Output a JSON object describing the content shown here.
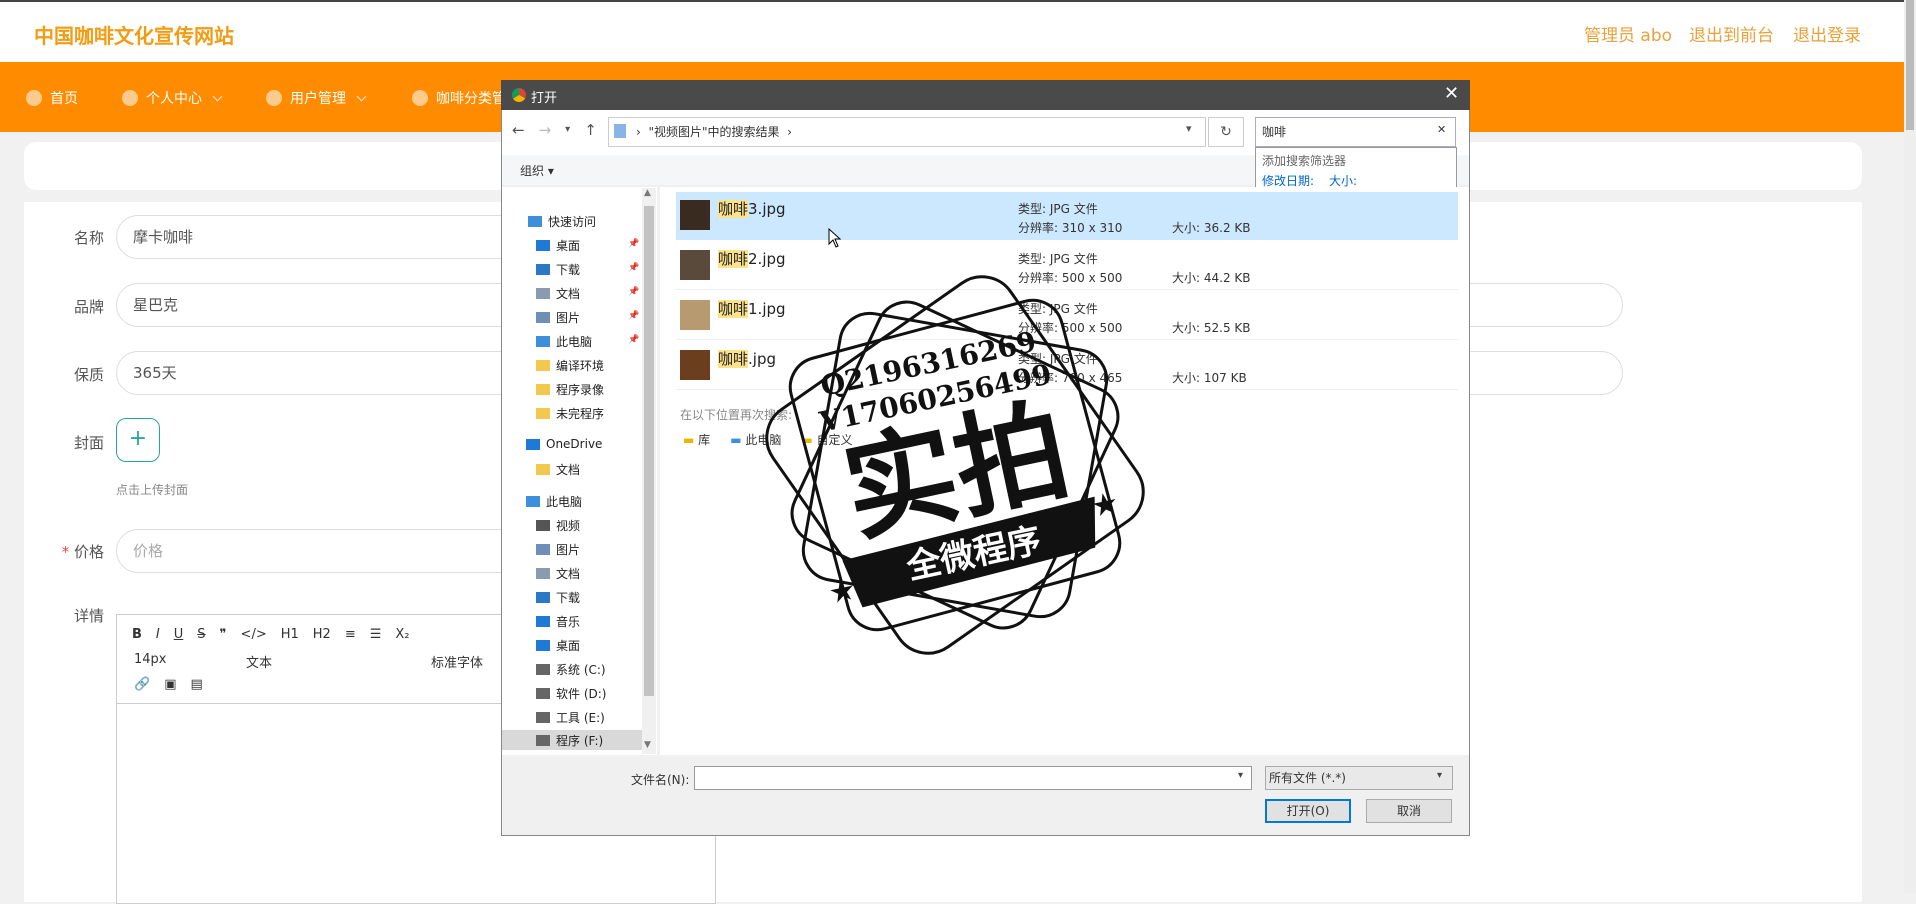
{
  "header": {
    "site_title": "中国咖啡文化宣传网站",
    "admin_label": "管理员 abo",
    "to_front": "退出到前台",
    "logout": "退出登录"
  },
  "nav": {
    "items": [
      {
        "label": "首页",
        "icon": "home-icon"
      },
      {
        "label": "个人中心",
        "icon": "user-icon"
      },
      {
        "label": "用户管理",
        "icon": "users-icon"
      },
      {
        "label": "咖啡分类管",
        "icon": "category-icon"
      }
    ]
  },
  "form": {
    "name_label": "名称",
    "name_value": "摩卡咖啡",
    "brand_label": "品牌",
    "brand_value": "星巴克",
    "shelf_label": "保质",
    "shelf_value": "365天",
    "cover_label": "封面",
    "cover_plus": "+",
    "cover_hint": "点击上传封面",
    "price_required": "*",
    "price_label": "价格",
    "price_placeholder": "价格",
    "detail_label": "详情"
  },
  "editor": {
    "row1": [
      "B",
      "I",
      "U",
      "S",
      "❞",
      "</>",
      "H1",
      "H2",
      "≡",
      "☰",
      "X₂"
    ],
    "font_size": "14px",
    "text_style": "文本",
    "font_family": "标准字体",
    "row3": [
      "link-icon",
      "image-icon",
      "video-icon"
    ]
  },
  "dialog": {
    "title": "打开",
    "close": "✕",
    "address_path": "\"视频图片\"中的搜索结果",
    "search_value": "咖啡",
    "search_clear": "✕",
    "filter_title": "添加搜索筛选器",
    "filter_date": "修改日期:",
    "filter_size": "大小:",
    "organize": "组织 ▾",
    "nav_items": [
      {
        "label": "快速访问",
        "icon": "star-icon"
      },
      {
        "label": "桌面",
        "icon": "desktop-icon",
        "pinned": true
      },
      {
        "label": "下载",
        "icon": "download-icon",
        "pinned": true
      },
      {
        "label": "文档",
        "icon": "document-icon",
        "pinned": true
      },
      {
        "label": "图片",
        "icon": "picture-icon",
        "pinned": true
      },
      {
        "label": "此电脑",
        "icon": "computer-icon",
        "pinned": true
      },
      {
        "label": "编译环境",
        "icon": "folder-icon"
      },
      {
        "label": "程序录像",
        "icon": "folder-icon"
      },
      {
        "label": "未完程序",
        "icon": "folder-icon"
      },
      {
        "label": "OneDrive",
        "icon": "cloud-icon"
      },
      {
        "label": "文档",
        "icon": "folder-icon"
      },
      {
        "label": "此电脑",
        "icon": "computer-icon"
      },
      {
        "label": "视频",
        "icon": "video-icon"
      },
      {
        "label": "图片",
        "icon": "picture-icon"
      },
      {
        "label": "文档",
        "icon": "document-icon"
      },
      {
        "label": "下载",
        "icon": "download-icon"
      },
      {
        "label": "音乐",
        "icon": "music-icon"
      },
      {
        "label": "桌面",
        "icon": "desktop-icon"
      },
      {
        "label": "系统 (C:)",
        "icon": "drive-icon"
      },
      {
        "label": "软件 (D:)",
        "icon": "drive-icon"
      },
      {
        "label": "工具 (E:)",
        "icon": "drive-icon"
      },
      {
        "label": "程序 (F:)",
        "icon": "drive-icon"
      }
    ],
    "files": [
      {
        "hl": "咖啡",
        "rest": "3.jpg",
        "type": "类型: JPG 文件",
        "res": "分辨率: 310 x 310",
        "size": "大小: 36.2 KB",
        "selected": true
      },
      {
        "hl": "咖啡",
        "rest": "2.jpg",
        "type": "类型: JPG 文件",
        "res": "分辨率: 500 x 500",
        "size": "大小: 44.2 KB"
      },
      {
        "hl": "咖啡",
        "rest": "1.jpg",
        "type": "类型: JPG 文件",
        "res": "分辨率: 500 x 500",
        "size": "大小: 52.5 KB"
      },
      {
        "hl": "咖啡",
        "rest": ".jpg",
        "type": "类型: JPG 文件",
        "res": "分辨率: 700 x 465",
        "size": "大小: 107 KB"
      }
    ],
    "search_again": "在以下位置再次搜索:",
    "locations": [
      "库",
      "此电脑",
      "自定义"
    ],
    "filename_label": "文件名(N):",
    "filetype_value": "所有文件 (*.*)",
    "open_button": "打开(O)",
    "cancel_button": "取消"
  },
  "watermark": {
    "contact1": "Q2196316269",
    "contact2": "V17060256499",
    "big_text": "实拍",
    "ribbon_text": "全微程序"
  },
  "colors": {
    "accent_orange": "#ff8c00",
    "title_orange": "#f39c12",
    "teal": "#29a89a",
    "selection": "#cce8ff"
  }
}
